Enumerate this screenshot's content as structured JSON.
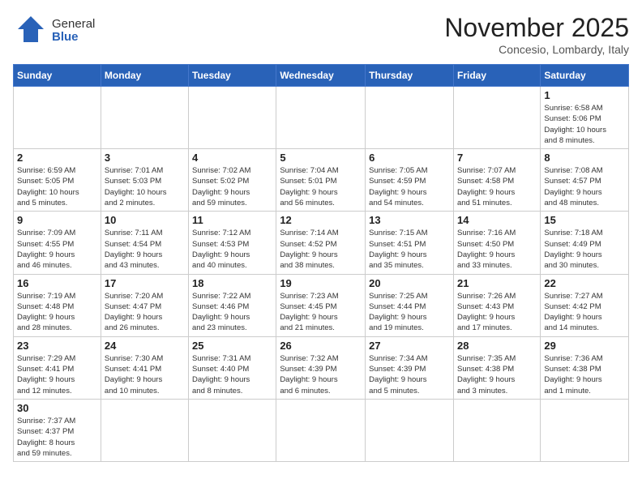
{
  "header": {
    "logo_general": "General",
    "logo_blue": "Blue",
    "title": "November 2025",
    "subtitle": "Concesio, Lombardy, Italy"
  },
  "weekdays": [
    "Sunday",
    "Monday",
    "Tuesday",
    "Wednesday",
    "Thursday",
    "Friday",
    "Saturday"
  ],
  "weeks": [
    [
      {
        "day": "",
        "info": ""
      },
      {
        "day": "",
        "info": ""
      },
      {
        "day": "",
        "info": ""
      },
      {
        "day": "",
        "info": ""
      },
      {
        "day": "",
        "info": ""
      },
      {
        "day": "",
        "info": ""
      },
      {
        "day": "1",
        "info": "Sunrise: 6:58 AM\nSunset: 5:06 PM\nDaylight: 10 hours\nand 8 minutes."
      }
    ],
    [
      {
        "day": "2",
        "info": "Sunrise: 6:59 AM\nSunset: 5:05 PM\nDaylight: 10 hours\nand 5 minutes."
      },
      {
        "day": "3",
        "info": "Sunrise: 7:01 AM\nSunset: 5:03 PM\nDaylight: 10 hours\nand 2 minutes."
      },
      {
        "day": "4",
        "info": "Sunrise: 7:02 AM\nSunset: 5:02 PM\nDaylight: 9 hours\nand 59 minutes."
      },
      {
        "day": "5",
        "info": "Sunrise: 7:04 AM\nSunset: 5:01 PM\nDaylight: 9 hours\nand 56 minutes."
      },
      {
        "day": "6",
        "info": "Sunrise: 7:05 AM\nSunset: 4:59 PM\nDaylight: 9 hours\nand 54 minutes."
      },
      {
        "day": "7",
        "info": "Sunrise: 7:07 AM\nSunset: 4:58 PM\nDaylight: 9 hours\nand 51 minutes."
      },
      {
        "day": "8",
        "info": "Sunrise: 7:08 AM\nSunset: 4:57 PM\nDaylight: 9 hours\nand 48 minutes."
      }
    ],
    [
      {
        "day": "9",
        "info": "Sunrise: 7:09 AM\nSunset: 4:55 PM\nDaylight: 9 hours\nand 46 minutes."
      },
      {
        "day": "10",
        "info": "Sunrise: 7:11 AM\nSunset: 4:54 PM\nDaylight: 9 hours\nand 43 minutes."
      },
      {
        "day": "11",
        "info": "Sunrise: 7:12 AM\nSunset: 4:53 PM\nDaylight: 9 hours\nand 40 minutes."
      },
      {
        "day": "12",
        "info": "Sunrise: 7:14 AM\nSunset: 4:52 PM\nDaylight: 9 hours\nand 38 minutes."
      },
      {
        "day": "13",
        "info": "Sunrise: 7:15 AM\nSunset: 4:51 PM\nDaylight: 9 hours\nand 35 minutes."
      },
      {
        "day": "14",
        "info": "Sunrise: 7:16 AM\nSunset: 4:50 PM\nDaylight: 9 hours\nand 33 minutes."
      },
      {
        "day": "15",
        "info": "Sunrise: 7:18 AM\nSunset: 4:49 PM\nDaylight: 9 hours\nand 30 minutes."
      }
    ],
    [
      {
        "day": "16",
        "info": "Sunrise: 7:19 AM\nSunset: 4:48 PM\nDaylight: 9 hours\nand 28 minutes."
      },
      {
        "day": "17",
        "info": "Sunrise: 7:20 AM\nSunset: 4:47 PM\nDaylight: 9 hours\nand 26 minutes."
      },
      {
        "day": "18",
        "info": "Sunrise: 7:22 AM\nSunset: 4:46 PM\nDaylight: 9 hours\nand 23 minutes."
      },
      {
        "day": "19",
        "info": "Sunrise: 7:23 AM\nSunset: 4:45 PM\nDaylight: 9 hours\nand 21 minutes."
      },
      {
        "day": "20",
        "info": "Sunrise: 7:25 AM\nSunset: 4:44 PM\nDaylight: 9 hours\nand 19 minutes."
      },
      {
        "day": "21",
        "info": "Sunrise: 7:26 AM\nSunset: 4:43 PM\nDaylight: 9 hours\nand 17 minutes."
      },
      {
        "day": "22",
        "info": "Sunrise: 7:27 AM\nSunset: 4:42 PM\nDaylight: 9 hours\nand 14 minutes."
      }
    ],
    [
      {
        "day": "23",
        "info": "Sunrise: 7:29 AM\nSunset: 4:41 PM\nDaylight: 9 hours\nand 12 minutes."
      },
      {
        "day": "24",
        "info": "Sunrise: 7:30 AM\nSunset: 4:41 PM\nDaylight: 9 hours\nand 10 minutes."
      },
      {
        "day": "25",
        "info": "Sunrise: 7:31 AM\nSunset: 4:40 PM\nDaylight: 9 hours\nand 8 minutes."
      },
      {
        "day": "26",
        "info": "Sunrise: 7:32 AM\nSunset: 4:39 PM\nDaylight: 9 hours\nand 6 minutes."
      },
      {
        "day": "27",
        "info": "Sunrise: 7:34 AM\nSunset: 4:39 PM\nDaylight: 9 hours\nand 5 minutes."
      },
      {
        "day": "28",
        "info": "Sunrise: 7:35 AM\nSunset: 4:38 PM\nDaylight: 9 hours\nand 3 minutes."
      },
      {
        "day": "29",
        "info": "Sunrise: 7:36 AM\nSunset: 4:38 PM\nDaylight: 9 hours\nand 1 minute."
      }
    ],
    [
      {
        "day": "30",
        "info": "Sunrise: 7:37 AM\nSunset: 4:37 PM\nDaylight: 8 hours\nand 59 minutes."
      },
      {
        "day": "",
        "info": ""
      },
      {
        "day": "",
        "info": ""
      },
      {
        "day": "",
        "info": ""
      },
      {
        "day": "",
        "info": ""
      },
      {
        "day": "",
        "info": ""
      },
      {
        "day": "",
        "info": ""
      }
    ]
  ]
}
